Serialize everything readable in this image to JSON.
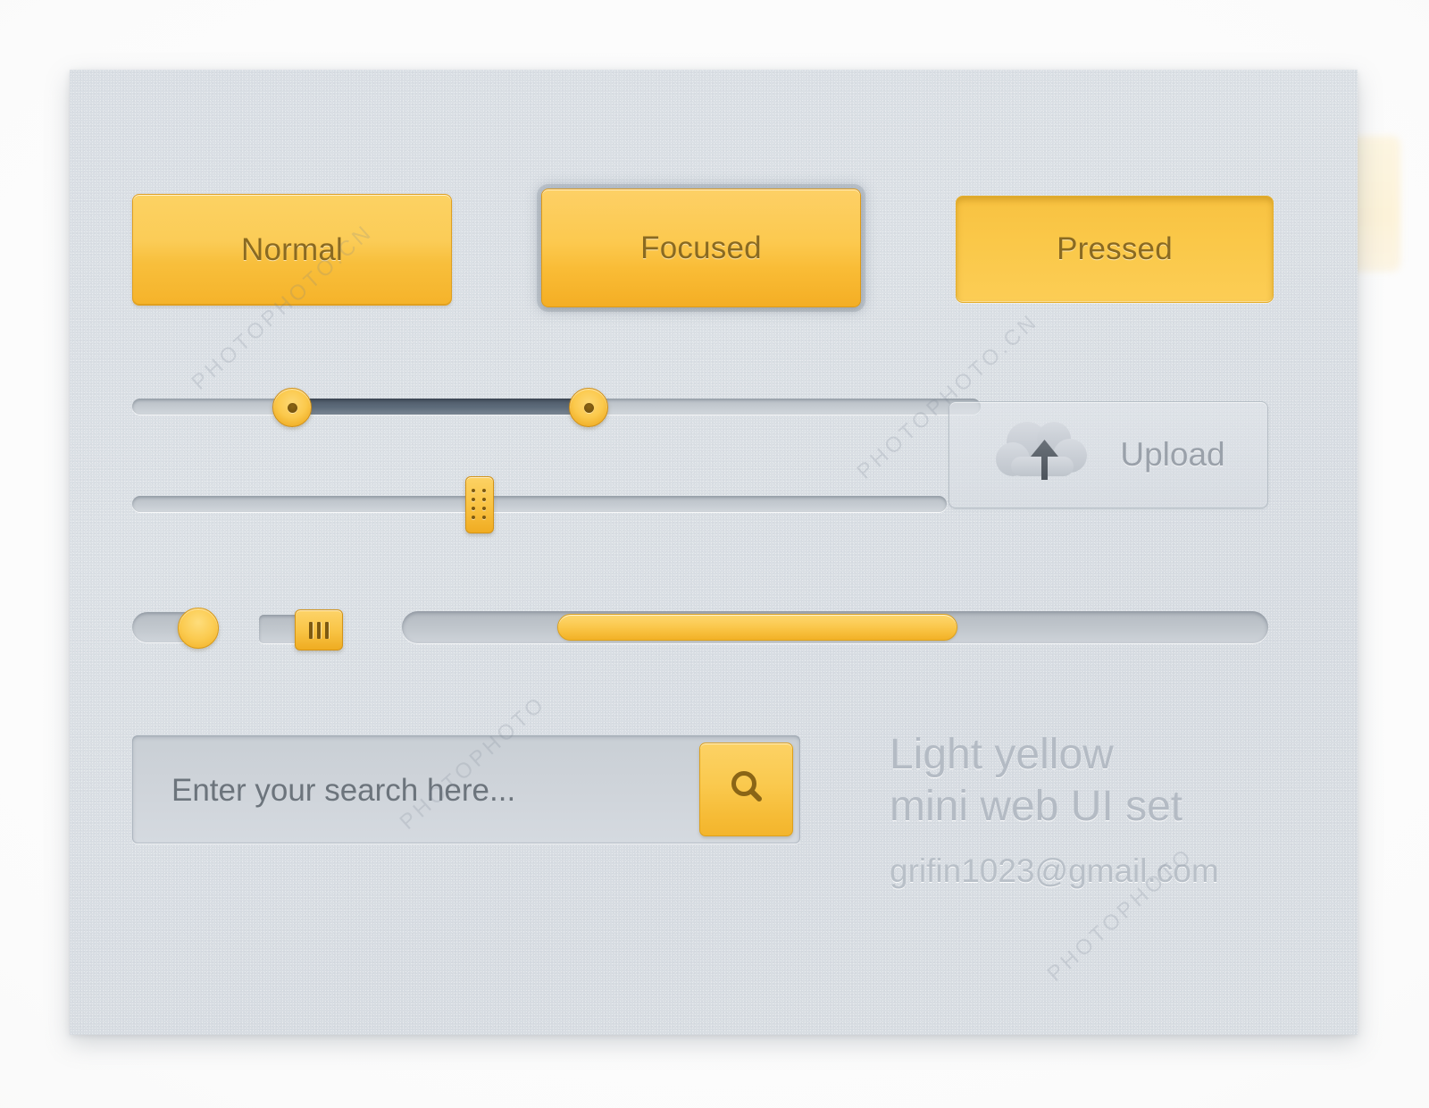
{
  "panel": {
    "background_color": "#d9dee4",
    "accent_color": "#fbc94f",
    "accent_dark": "#e09f1e",
    "text_muted": "#b4bbc4"
  },
  "buttons": [
    {
      "id": "normal",
      "label": "Normal",
      "state": "normal"
    },
    {
      "id": "focused",
      "label": "Focused",
      "state": "focused"
    },
    {
      "id": "pressed",
      "label": "Pressed",
      "state": "pressed"
    }
  ],
  "range_slider": {
    "name": "dual-handle range slider",
    "low_percent": 18,
    "high_percent": 53,
    "fill_color": "#5d6b7a",
    "handle_color": "#fbc94c"
  },
  "grip_slider": {
    "name": "single handle slider",
    "value_percent": 42,
    "handle_color": "#f9c445",
    "handle_dots": 8
  },
  "toggles": [
    {
      "id": "round",
      "name": "round toggle switch",
      "state": "on",
      "knob_color": "#fbcb50"
    },
    {
      "id": "square",
      "name": "square toggle switch",
      "state": "on",
      "knob_color": "#f9c547",
      "knob_bars": 3
    }
  ],
  "progress": {
    "name": "progress bar",
    "start_percent": 18,
    "end_percent": 64,
    "fill_color": "#fbc94f"
  },
  "upload": {
    "label": "Upload",
    "icon": "cloud-upload-icon"
  },
  "search": {
    "value": "",
    "placeholder": "Enter your search here...",
    "button_icon": "search-icon"
  },
  "title_block": {
    "line1": "Light yellow",
    "line2": "mini web UI set",
    "email": "grifin1023@gmail.com"
  },
  "watermarks": {
    "latin": "PHOTOPHOTO.CN",
    "short": "PHOTOPHOTO"
  }
}
